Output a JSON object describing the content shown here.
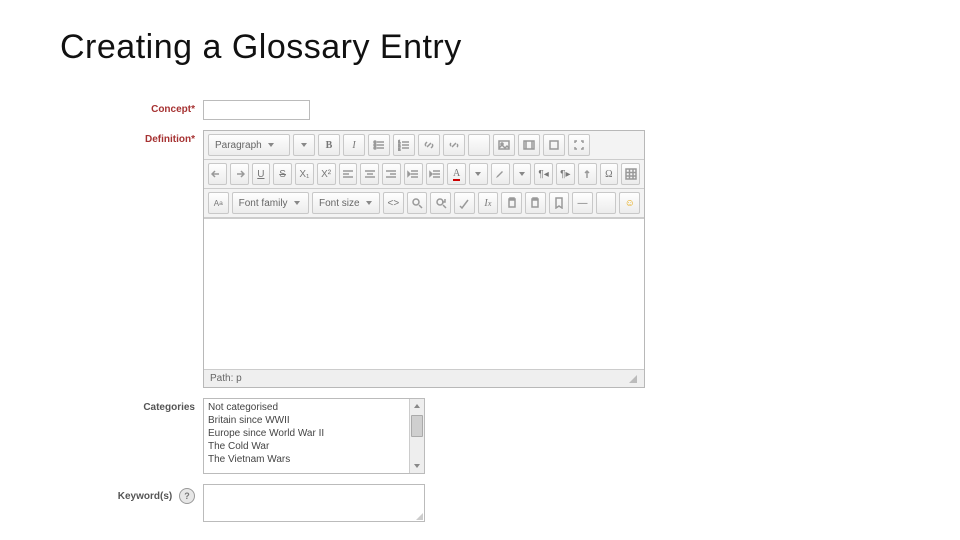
{
  "title": "Creating a Glossary Entry",
  "labels": {
    "concept": "Concept",
    "definition": "Definition",
    "categories": "Categories",
    "keywords": "Keyword(s)",
    "required": "*"
  },
  "editor": {
    "format_dropdown": "Paragraph",
    "font_family": "Font family",
    "font_size": "Font size",
    "path_label": "Path:",
    "path_value": "p",
    "icons": {
      "bold": "B",
      "italic": "I",
      "bullets": "≣",
      "numbers": "≡",
      "link": "🔗",
      "unlink": "⛓",
      "blank": " ",
      "image": "▣",
      "media": "▥",
      "equation": "□",
      "fullscreen": "⤢",
      "undo": "↶",
      "redo": "↷",
      "underline": "U",
      "strike": "S",
      "sub": "X₁",
      "sup": "X²",
      "align_l": "≡",
      "align_c": "≡",
      "align_r": "≡",
      "indent_l": "⇤",
      "indent_r": "⇥",
      "fontcolor": "A",
      "brush": "✎",
      "ltr": "¶",
      "rtl": "¶",
      "outdent": "⤒",
      "omega": "Ω",
      "table": "▦",
      "css": "ᴬ",
      "html": "<>",
      "find": "🔍",
      "replace": "🔎",
      "spell": "✔",
      "clear": "⌫",
      "paste": "📋",
      "copy": "📋",
      "bookmark": "⚐",
      "hr": "—",
      "smiley": "☺"
    }
  },
  "categories": [
    "Not categorised",
    "Britain since WWII",
    "Europe since World War II",
    "The Cold War",
    "The Vietnam Wars"
  ]
}
